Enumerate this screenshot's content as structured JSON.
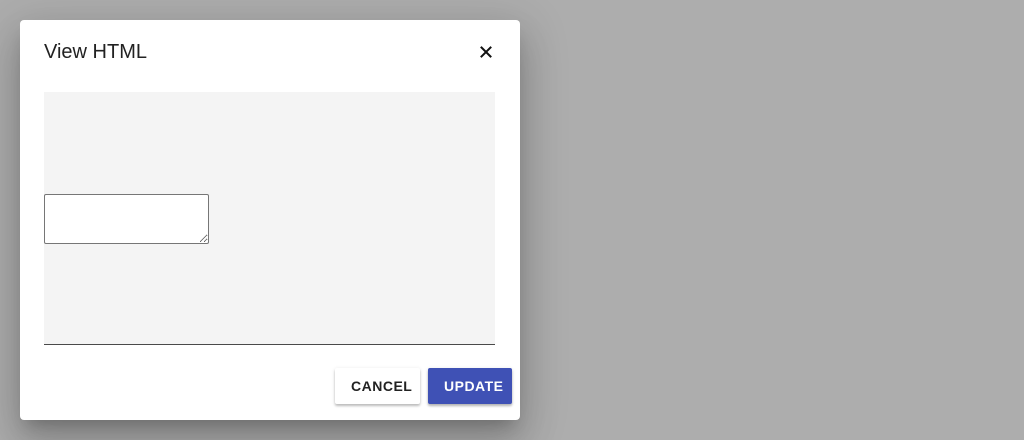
{
  "dialog": {
    "title": "View HTML",
    "close_icon": "close-icon",
    "textarea_value": "",
    "cancel_label": "CANCEL",
    "update_label": "UPDATE"
  },
  "colors": {
    "backdrop": "#adadad",
    "dialog_bg": "#ffffff",
    "editor_bg": "#f4f4f4",
    "primary": "#3f51b5"
  }
}
